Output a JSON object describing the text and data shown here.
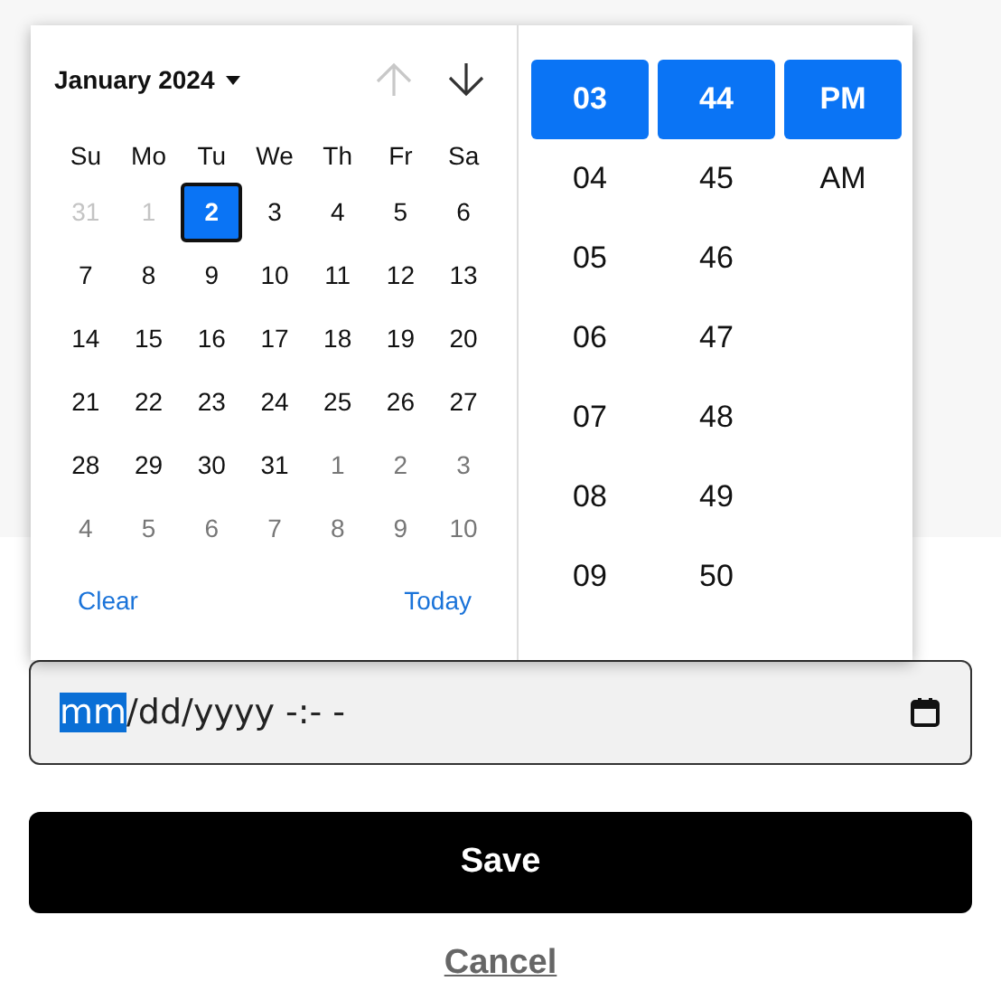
{
  "calendar": {
    "month_label": "January 2024",
    "prev_disabled": true,
    "next_disabled": false,
    "weekdays": [
      "Su",
      "Mo",
      "Tu",
      "We",
      "Th",
      "Fr",
      "Sa"
    ],
    "days": [
      {
        "label": "31",
        "kind": "prev",
        "selected": false
      },
      {
        "label": "1",
        "kind": "prev",
        "selected": false
      },
      {
        "label": "2",
        "kind": "current",
        "selected": true
      },
      {
        "label": "3",
        "kind": "current",
        "selected": false
      },
      {
        "label": "4",
        "kind": "current",
        "selected": false
      },
      {
        "label": "5",
        "kind": "current",
        "selected": false
      },
      {
        "label": "6",
        "kind": "current",
        "selected": false
      },
      {
        "label": "7",
        "kind": "current",
        "selected": false
      },
      {
        "label": "8",
        "kind": "current",
        "selected": false
      },
      {
        "label": "9",
        "kind": "current",
        "selected": false
      },
      {
        "label": "10",
        "kind": "current",
        "selected": false
      },
      {
        "label": "11",
        "kind": "current",
        "selected": false
      },
      {
        "label": "12",
        "kind": "current",
        "selected": false
      },
      {
        "label": "13",
        "kind": "current",
        "selected": false
      },
      {
        "label": "14",
        "kind": "current",
        "selected": false
      },
      {
        "label": "15",
        "kind": "current",
        "selected": false
      },
      {
        "label": "16",
        "kind": "current",
        "selected": false
      },
      {
        "label": "17",
        "kind": "current",
        "selected": false
      },
      {
        "label": "18",
        "kind": "current",
        "selected": false
      },
      {
        "label": "19",
        "kind": "current",
        "selected": false
      },
      {
        "label": "20",
        "kind": "current",
        "selected": false
      },
      {
        "label": "21",
        "kind": "current",
        "selected": false
      },
      {
        "label": "22",
        "kind": "current",
        "selected": false
      },
      {
        "label": "23",
        "kind": "current",
        "selected": false
      },
      {
        "label": "24",
        "kind": "current",
        "selected": false
      },
      {
        "label": "25",
        "kind": "current",
        "selected": false
      },
      {
        "label": "26",
        "kind": "current",
        "selected": false
      },
      {
        "label": "27",
        "kind": "current",
        "selected": false
      },
      {
        "label": "28",
        "kind": "current",
        "selected": false
      },
      {
        "label": "29",
        "kind": "current",
        "selected": false
      },
      {
        "label": "30",
        "kind": "current",
        "selected": false
      },
      {
        "label": "31",
        "kind": "current",
        "selected": false
      },
      {
        "label": "1",
        "kind": "next",
        "selected": false
      },
      {
        "label": "2",
        "kind": "next",
        "selected": false
      },
      {
        "label": "3",
        "kind": "next",
        "selected": false
      },
      {
        "label": "4",
        "kind": "next",
        "selected": false
      },
      {
        "label": "5",
        "kind": "next",
        "selected": false
      },
      {
        "label": "6",
        "kind": "next",
        "selected": false
      },
      {
        "label": "7",
        "kind": "next",
        "selected": false
      },
      {
        "label": "8",
        "kind": "next",
        "selected": false
      },
      {
        "label": "9",
        "kind": "next",
        "selected": false
      },
      {
        "label": "10",
        "kind": "next",
        "selected": false
      }
    ],
    "footer": [
      "Clear",
      "Today"
    ]
  },
  "time_columns": [
    {
      "items": [
        {
          "label": "03",
          "selected": true
        },
        {
          "label": "04",
          "selected": false
        },
        {
          "label": "05",
          "selected": false
        },
        {
          "label": "06",
          "selected": false
        },
        {
          "label": "07",
          "selected": false
        },
        {
          "label": "08",
          "selected": false
        },
        {
          "label": "09",
          "selected": false
        }
      ]
    },
    {
      "items": [
        {
          "label": "44",
          "selected": true
        },
        {
          "label": "45",
          "selected": false
        },
        {
          "label": "46",
          "selected": false
        },
        {
          "label": "47",
          "selected": false
        },
        {
          "label": "48",
          "selected": false
        },
        {
          "label": "49",
          "selected": false
        },
        {
          "label": "50",
          "selected": false
        }
      ]
    },
    {
      "items": [
        {
          "label": "PM",
          "selected": true
        },
        {
          "label": "AM",
          "selected": false
        }
      ]
    }
  ],
  "date_field": {
    "segments": [
      {
        "text": "mm",
        "selected": true
      },
      {
        "text": "/dd/yyyy",
        "selected": false
      },
      {
        "text": " -:- -",
        "selected": false
      }
    ]
  },
  "save_button": "Save",
  "cancel_link": "Cancel"
}
